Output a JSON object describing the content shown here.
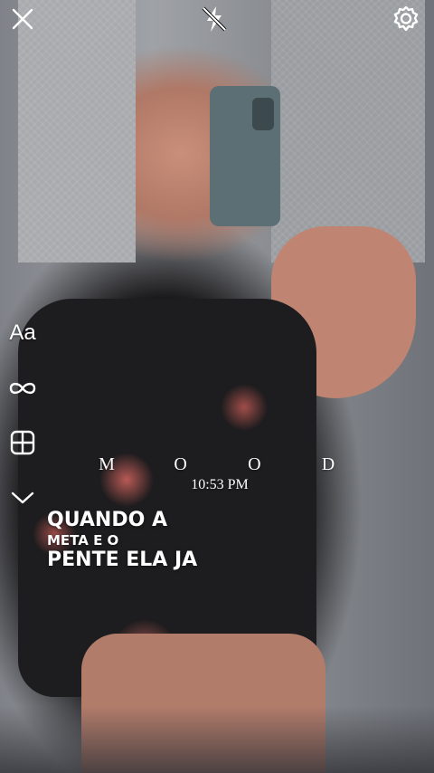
{
  "toolbar": {
    "close_icon": "close-icon",
    "flash_icon": "flash-off-icon",
    "settings_icon": "gear-icon"
  },
  "tools": {
    "text_label": "Aa",
    "boomerang_icon": "infinity-icon",
    "layout_icon": "layout-icon",
    "more_icon": "chevron-down-icon"
  },
  "overlay": {
    "mood_letters": [
      "M",
      "O",
      "O",
      "D"
    ],
    "time": "10:53 PM",
    "caption_line1": "QUANDO A",
    "caption_line2": "META E O",
    "caption_line3": "PENTE ELA JA"
  }
}
